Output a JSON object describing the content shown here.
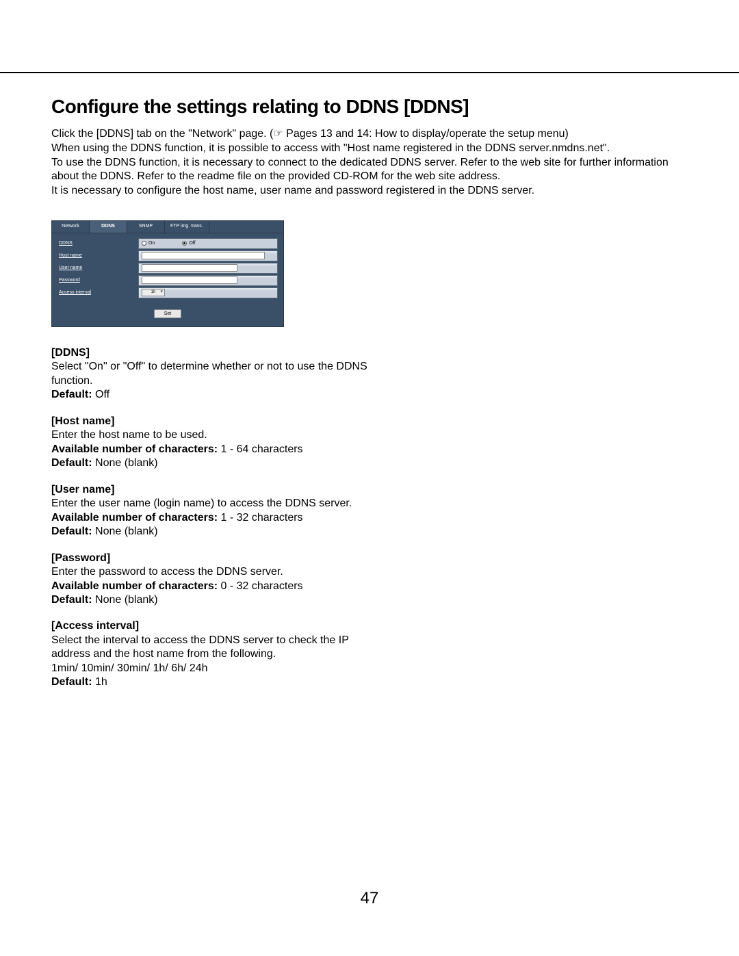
{
  "page_number": "47",
  "heading": "Configure the settings relating to DDNS [DDNS]",
  "intro": [
    "Click the [DDNS] tab on the \"Network\" page. (☞ Pages 13 and 14: How to display/operate the setup menu)",
    "When using the DDNS function, it is possible to access with \"Host name registered in the DDNS server.nmdns.net\".",
    "To use the DDNS function, it is necessary to connect to the dedicated DDNS server. Refer to the web site for further information about the DDNS. Refer to the readme file on the provided CD-ROM for the web site address.",
    "It is necessary to configure the host name, user name and password registered in the DDNS server."
  ],
  "screenshot": {
    "tabs": [
      "Network",
      "DDNS",
      "SNMP",
      "FTP img. trans."
    ],
    "active_tab": "DDNS",
    "rows": {
      "ddns": "DDNS",
      "host": "Host name",
      "user": "User name",
      "pass": "Password",
      "interval": "Access interval"
    },
    "radio_on": "On",
    "radio_off": "Off",
    "interval_value": "1h",
    "set_button": "Set"
  },
  "sections": [
    {
      "title": "[DDNS]",
      "body": "Select \"On\" or \"Off\" to determine whether or not to use the DDNS function.",
      "extras": [
        {
          "label": "Default:",
          "value": " Off"
        }
      ]
    },
    {
      "title": "[Host name]",
      "body": "Enter the host name to be used.",
      "extras": [
        {
          "label": "Available number of characters:",
          "value": " 1 - 64 characters"
        },
        {
          "label": "Default:",
          "value": " None (blank)"
        }
      ]
    },
    {
      "title": "[User name]",
      "body": "Enter the user name (login name) to access the DDNS server.",
      "extras": [
        {
          "label": "Available number of characters:",
          "value": " 1 - 32 characters"
        },
        {
          "label": "Default:",
          "value": " None (blank)"
        }
      ]
    },
    {
      "title": "[Password]",
      "body": "Enter the password to access the DDNS server.",
      "extras": [
        {
          "label": "Available number of characters:",
          "value": " 0 - 32 characters"
        },
        {
          "label": "Default:",
          "value": " None (blank)"
        }
      ]
    },
    {
      "title": "[Access interval]",
      "body": "Select the interval to access the DDNS server to check the IP address and the host name from the following.",
      "body2": "1min/ 10min/ 30min/ 1h/ 6h/ 24h",
      "extras": [
        {
          "label": "Default:",
          "value": " 1h"
        }
      ]
    }
  ]
}
